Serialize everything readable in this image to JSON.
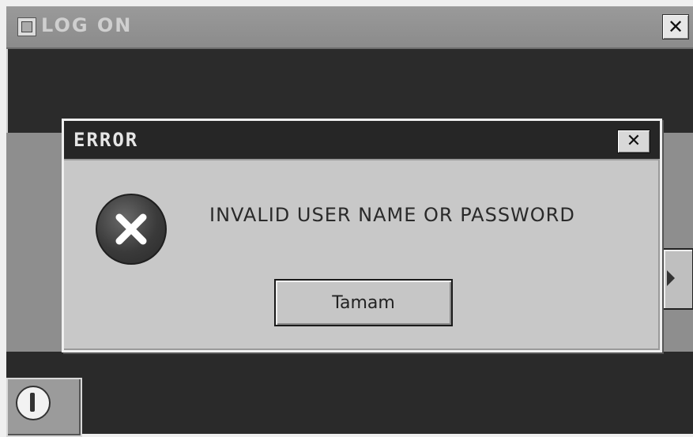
{
  "logon_window": {
    "title": "LOG ON",
    "close_label": "✕",
    "app_icon": "app-icon",
    "power_icon": "power-icon",
    "arrow_icon": "arrow-right-icon"
  },
  "error_dialog": {
    "title": "ERROR",
    "close_label": "✕",
    "icon": "error-x-icon",
    "message": "INVALID USER NAME OR PASSWORD",
    "ok_button_label": "Tamam"
  }
}
